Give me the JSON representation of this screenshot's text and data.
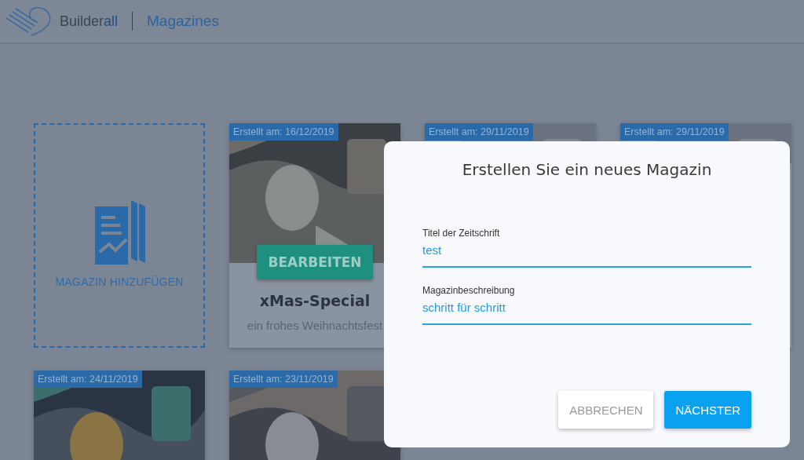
{
  "header": {
    "brand": [
      "Builder",
      "all"
    ],
    "section": "Magazines"
  },
  "add_card": {
    "label": "MAGAZIN HINZUFÜGEN"
  },
  "magazines": [
    {
      "date": "Erstellt am: 16/12/2019",
      "button": "BEARBEITEN",
      "title": "xMas-Special",
      "description": "ein frohes Weihnachtsfest"
    },
    {
      "date": "Erstellt am: 29/11/2019"
    },
    {
      "date": "Erstellt am: 29/11/2019"
    },
    {
      "date": "Erstellt am: 24/11/2019"
    },
    {
      "date": "Erstellt am: 23/11/2019"
    }
  ],
  "dialog": {
    "title": "Erstellen Sie ein neues Magazin",
    "fields": [
      {
        "label": "Titel der Zeitschrift",
        "value": "test"
      },
      {
        "label": "Magazinbeschreibung",
        "value": "schritt für schritt"
      }
    ],
    "buttons": [
      {
        "label": "ABBRECHEN",
        "kind": "secondary"
      },
      {
        "label": "NÄCHSTER",
        "kind": "primary"
      }
    ]
  }
}
